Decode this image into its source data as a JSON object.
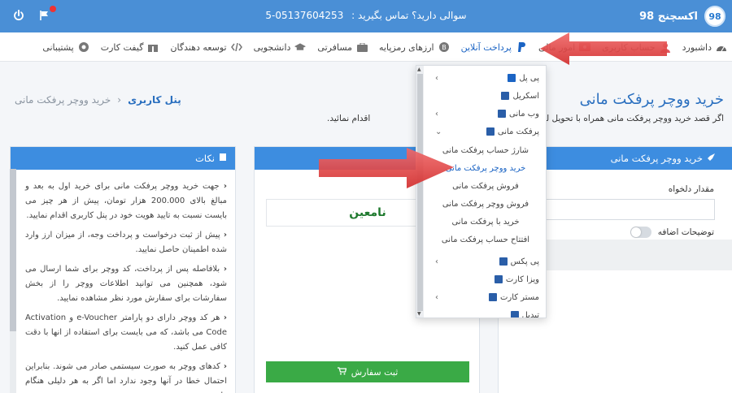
{
  "topbar": {
    "brand_name": "اکسچنج 98",
    "brand_logo_text": "98",
    "support_text": "سوالی دارید؟ تماس بگیرید :",
    "support_phone": "05137604253-5"
  },
  "nav": {
    "items": [
      {
        "label": "داشبورد",
        "icon": "dashboard-icon"
      },
      {
        "label": "حساب کاربری",
        "icon": "user-icon"
      },
      {
        "label": "امور مالی",
        "icon": "money-icon"
      },
      {
        "label": "پرداخت آنلاین",
        "icon": "paypal-icon"
      },
      {
        "label": "ارزهای رمزپایه",
        "icon": "bitcoin-icon"
      },
      {
        "label": "مسافرتی",
        "icon": "suitcase-icon"
      },
      {
        "label": "دانشجویی",
        "icon": "graduation-cap-icon"
      },
      {
        "label": "توسعه دهندگان",
        "icon": "code-icon"
      },
      {
        "label": "گیفت کارت",
        "icon": "gift-icon"
      },
      {
        "label": "پشتیبانی",
        "icon": "support-icon"
      }
    ]
  },
  "page": {
    "title": "خرید ووچر پرفکت مانی",
    "description": "اگر قصد خرید ووچر پرفکت مانی همراه با تحویل لح",
    "description_tail": "اقدام نمائید.",
    "breadcrumb_home": "پنل کاربری",
    "breadcrumb_sep": "›",
    "breadcrumb_current": "خرید ووچر پرفکت مانی"
  },
  "dropdown": {
    "items": [
      {
        "label": "پی پل",
        "chev": "‹",
        "icon_color": "#1b64c4"
      },
      {
        "label": "اسکریل",
        "chev": "",
        "icon_color": "#2a5ea8"
      },
      {
        "label": "وب مانی",
        "chev": "‹",
        "icon_color": "#2a5ea8"
      },
      {
        "label": "پرفکت مانی",
        "chev": "⌄",
        "icon_color": "#2a5ea8"
      }
    ],
    "sub_items": [
      "شارژ حساب پرفکت مانی",
      "خرید ووچر پرفکت مانی",
      "فروش پرفکت مانی",
      "فروش ووچر پرفکت مانی",
      "خرید با پرفکت مانی",
      "افتتاح حساب پرفکت مانی"
    ],
    "items_after": [
      {
        "label": "پی پکس",
        "chev": "‹",
        "icon_color": "#2a5ea8"
      },
      {
        "label": "ویزا کارت",
        "chev": "",
        "icon_color": "#2a5ea8"
      },
      {
        "label": "مستر کارت",
        "chev": "‹",
        "icon_color": "#2a5ea8"
      },
      {
        "label": "تبدیل",
        "chev": "",
        "icon_color": "#2a5ea8"
      }
    ]
  },
  "notes_card": {
    "title": "نکات",
    "paragraphs": [
      "جهت خرید ووچر پرفکت مانی برای خرید اول به بعد و مبالغ بالای 200.000 هزار تومان، پیش از هر چیز می بایست نسبت به تایید هویت خود در پنل کاربری اقدام نمایید.",
      "پیش از ثبت درخواست و پرداخت وجه، از میزان ارز وارد شده اطمینان حاصل نمایید.",
      "بلافاصله پس از پرداخت، کد ووچر برای شما ارسال می شود، همچنین می توانید اطلاعات ووچر را از بخش سفارشات برای سفارش مورد نظر مشاهده نمایید.",
      "هر کد ووچر دارای دو پارامتر e-Voucher و Activation Code می باشد، که می بایست برای استفاده از انها با دقت کافی عمل کنید.",
      "کدهای ووچر به صورت سیستمی صادر می شوند. بنابراین احتمال خطا در آنها وجود ندارد اما اگر به هر دلیلی هنگام وارد"
    ]
  },
  "middle_card": {
    "status_text": "نامعین",
    "submit_label": "ثبت سفارش"
  },
  "order_card": {
    "title": "خرید ووچر پرفکت مانی",
    "amount_label": "مقدار دلخواه",
    "extra_label": "توضیحات اضافه"
  },
  "colors": {
    "primary": "#4a8fd6",
    "card_header": "#3d8de0",
    "success": "#3aaa46",
    "arrow": "#e23b3b"
  }
}
